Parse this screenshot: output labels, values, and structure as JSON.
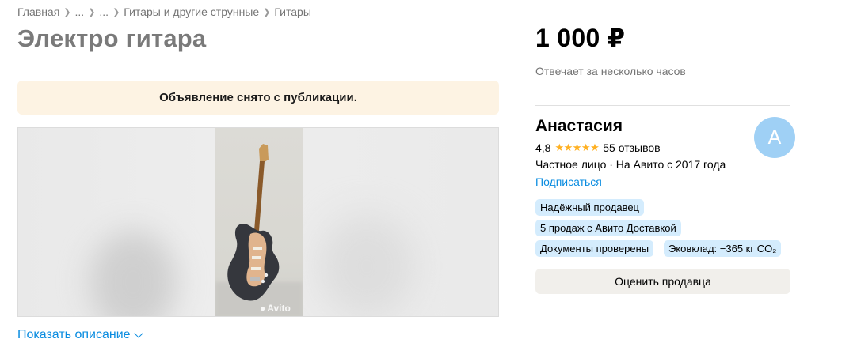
{
  "breadcrumb": {
    "items": [
      "Главная",
      "...",
      "...",
      "Гитары и другие струнные",
      "Гитары"
    ],
    "separator": ">"
  },
  "title": "Электро гитара",
  "notice": "Объявление снято с публикации.",
  "gallery": {
    "watermark": "Avito"
  },
  "show_description": "Показать описание",
  "price": "1 000 ₽",
  "response_time": "Отвечает за несколько часов",
  "seller": {
    "name": "Анастасия",
    "rating": "4,8",
    "stars": "★★★★★",
    "reviews": "55 отзывов",
    "meta": "Частное лицо · На Авито с 2017 года",
    "subscribe": "Подписаться",
    "avatar_letter": "А",
    "badges": [
      "Надёжный продавец",
      "5 продаж с Авито Доставкой",
      "Документы проверены",
      "Эковклад: −365 кг CO₂"
    ],
    "rate_button": "Оценить продавца"
  },
  "colors": {
    "link": "#0a8ce0",
    "notice_bg": "#fdf3e3",
    "badge_bg": "#d4ecfd",
    "star": "#ffb021",
    "avatar_bg": "#9fd0f5"
  }
}
